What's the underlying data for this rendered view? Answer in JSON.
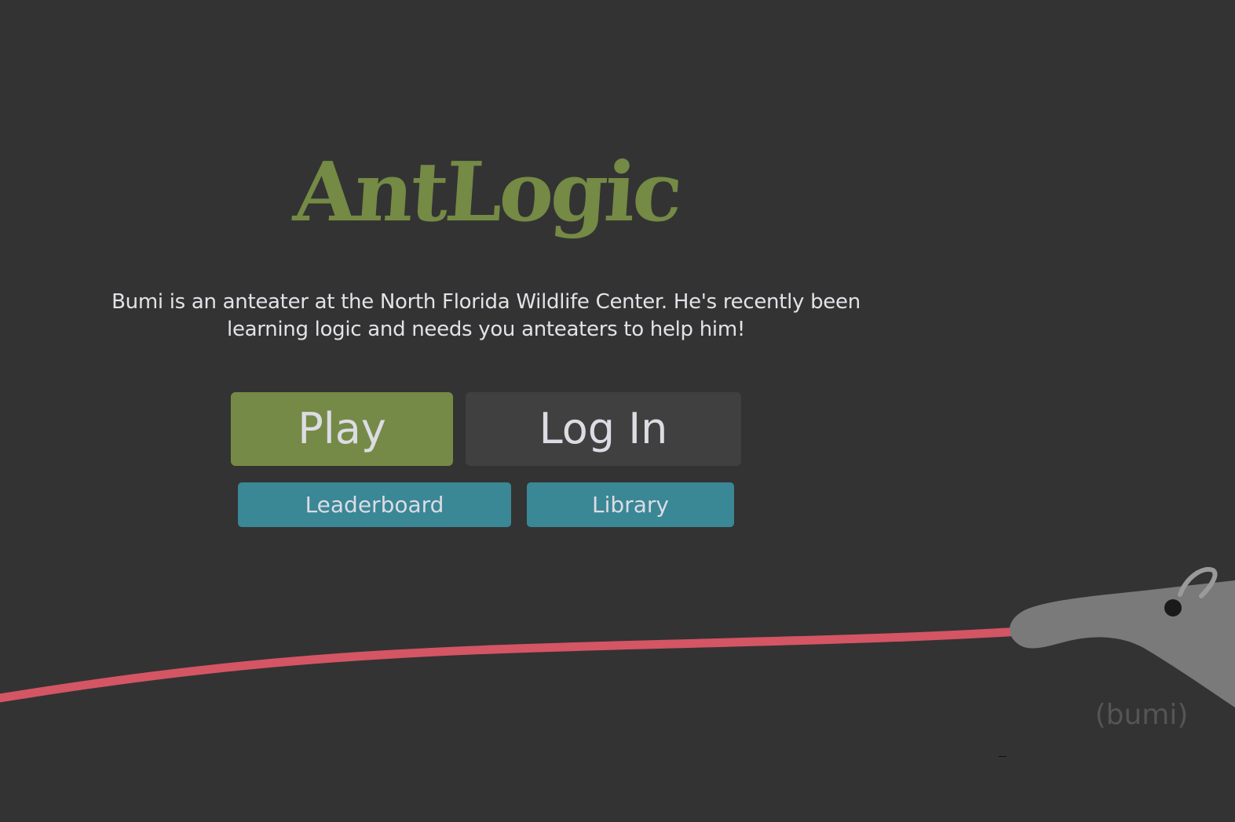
{
  "app": {
    "logo_text": "AntLogic",
    "description": "Bumi is an anteater at the North Florida Wildlife Center. He's recently been learning logic and needs you anteaters to help him!"
  },
  "buttons": {
    "play": "Play",
    "login": "Log In",
    "leaderboard": "Leaderboard",
    "library": "Library"
  },
  "mascot": {
    "caption": "(bumi)"
  },
  "colors": {
    "background": "#333333",
    "brand_green": "#748a45",
    "play_button": "#768a47",
    "login_button": "#404040",
    "secondary_button": "#3a8796",
    "button_text": "#dcdce4",
    "tongue": "#d45564",
    "anteater": "#7a7a7a"
  }
}
